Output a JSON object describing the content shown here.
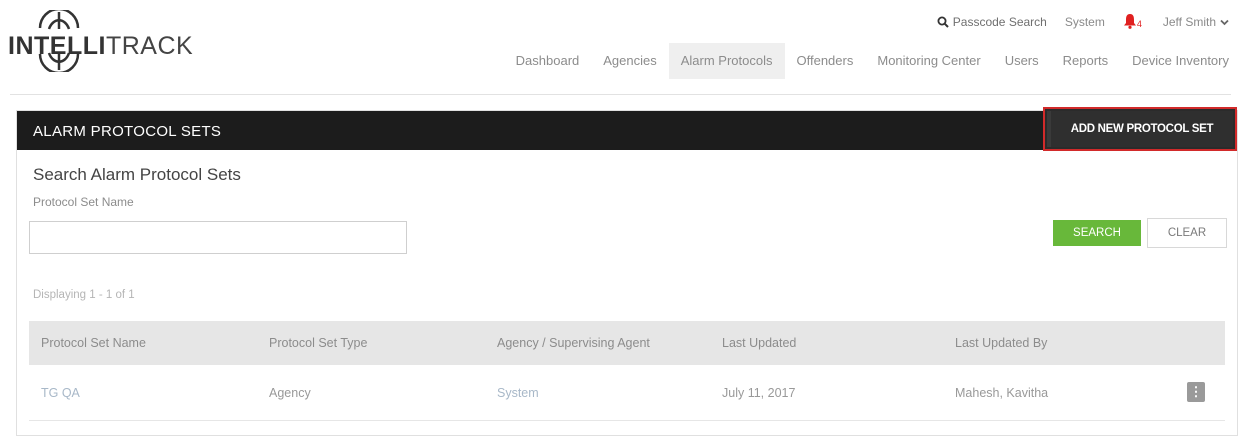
{
  "brand": {
    "name_bold": "INTELLI",
    "name_light": "TRACK"
  },
  "utility": {
    "passcode_search": "Passcode Search",
    "system": "System",
    "alert_count": "4",
    "user_name": "Jeff Smith"
  },
  "nav": {
    "items": [
      {
        "label": "Dashboard"
      },
      {
        "label": "Agencies"
      },
      {
        "label": "Alarm Protocols"
      },
      {
        "label": "Offenders"
      },
      {
        "label": "Monitoring Center"
      },
      {
        "label": "Users"
      },
      {
        "label": "Reports"
      },
      {
        "label": "Device Inventory"
      }
    ],
    "active": "Alarm Protocols"
  },
  "panel": {
    "title": "ALARM PROTOCOL SETS",
    "add_button": "ADD NEW PROTOCOL SET"
  },
  "search": {
    "title": "Search Alarm Protocol Sets",
    "field_label": "Protocol Set Name",
    "field_value": "",
    "search_button": "SEARCH",
    "clear_button": "CLEAR"
  },
  "results": {
    "count_text": "Displaying 1 - 1 of 1",
    "columns": [
      "Protocol Set Name",
      "Protocol Set Type",
      "Agency / Supervising Agent",
      "Last Updated",
      "Last Updated By"
    ],
    "rows": [
      {
        "name": "TG QA",
        "type": "Agency",
        "agency": "System",
        "updated": "July 11, 2017",
        "updated_by": "Mahesh, Kavitha"
      }
    ]
  },
  "colors": {
    "header_bar": "#1c1c1c",
    "highlight_border": "#d22a2a",
    "search_button": "#68b83a",
    "alert_bell": "#e02020"
  }
}
